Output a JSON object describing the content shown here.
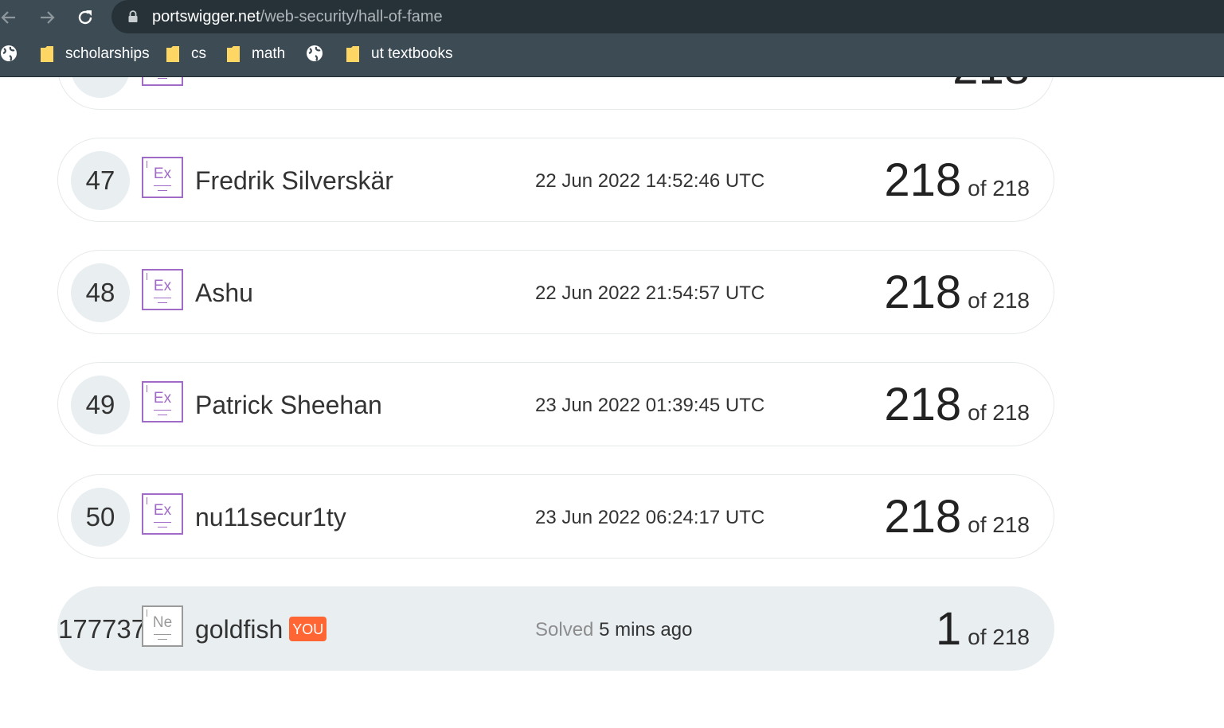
{
  "browser": {
    "url_host": "portswigger.net",
    "url_path": "/web-security/hall-of-fame",
    "bookmarks": [
      {
        "type": "folder",
        "label": "scholarships"
      },
      {
        "type": "folder",
        "label": "cs"
      },
      {
        "type": "folder",
        "label": "math"
      },
      {
        "type": "folder",
        "label": "ut textbooks"
      }
    ]
  },
  "leaderboard": {
    "partial_row": {
      "score": "218"
    },
    "rows": [
      {
        "rank": "47",
        "badge": "Ex",
        "name": "Fredrik Silverskär",
        "date": "22 Jun 2022 14:52:46 UTC",
        "score": "218",
        "total": "of 218"
      },
      {
        "rank": "48",
        "badge": "Ex",
        "name": "Ashu",
        "date": "22 Jun 2022 21:54:57 UTC",
        "score": "218",
        "total": "of 218"
      },
      {
        "rank": "49",
        "badge": "Ex",
        "name": "Patrick Sheehan",
        "date": "23 Jun 2022 01:39:45 UTC",
        "score": "218",
        "total": "of 218"
      },
      {
        "rank": "50",
        "badge": "Ex",
        "name": "nu11secur1ty",
        "date": "23 Jun 2022 06:24:17 UTC",
        "score": "218",
        "total": "of 218"
      }
    ],
    "you_row": {
      "rank": "177737",
      "badge": "Ne",
      "name": "goldfish",
      "tag": "YOU",
      "solved_label": "Solved",
      "solved_time": "5 mins ago",
      "score": "1",
      "total": "of 218"
    }
  },
  "colors": {
    "chrome": "#3c4b54",
    "omnibox": "#263238",
    "expert_badge": "#a06bc7",
    "you_tag": "#ff6633",
    "you_row_bg": "#e9eef1"
  }
}
